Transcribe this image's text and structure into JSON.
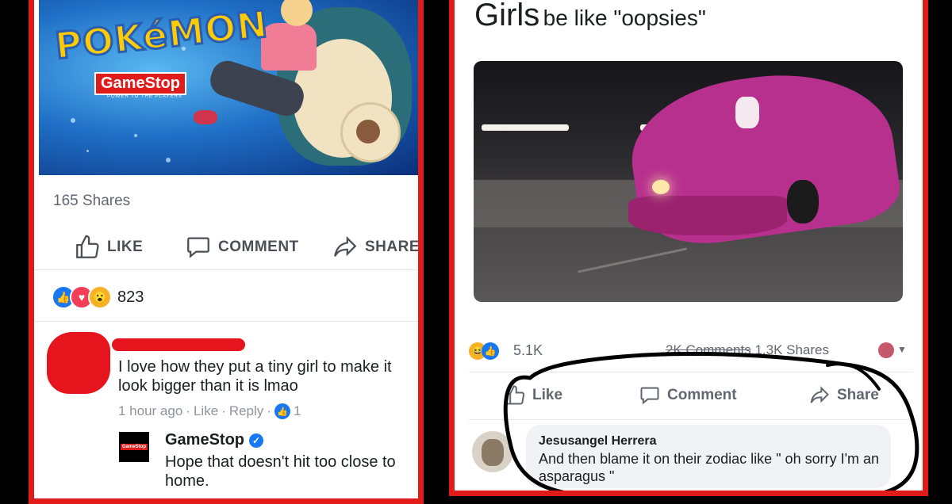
{
  "left_post": {
    "promo_image": {
      "brand_logo": "POKéMON",
      "store_logo": "GameStop",
      "store_tagline": "POWER TO THE PLAYERS"
    },
    "shares": "165 Shares",
    "actions": {
      "like": "LIKE",
      "comment": "COMMENT",
      "share": "SHARE"
    },
    "reactions": {
      "count": "823",
      "types": [
        "like",
        "love",
        "wow"
      ]
    },
    "comment": {
      "text": "I love how they put a tiny girl to make it look bigger than it is lmao",
      "meta": {
        "time": "1 hour ago",
        "like": "Like",
        "reply": "Reply",
        "like_count": "1"
      }
    },
    "reply": {
      "author": "GameStop",
      "avatar_text": "GameStop",
      "text": "Hope that doesn't hit too close to home."
    }
  },
  "right_post": {
    "caption": {
      "bold": "Girls",
      "rest": "be like \"oopsies\""
    },
    "stats": {
      "reaction_count": "5.1K",
      "comments": "2K Comments",
      "shares": "1.3K Shares",
      "reaction_types": [
        "haha",
        "like"
      ]
    },
    "actions": {
      "like": "Like",
      "comment": "Comment",
      "share": "Share"
    },
    "comment": {
      "author": "Jesusangel Herrera",
      "text": "And then blame it on their zodiac like \" oh sorry I'm an asparagus \""
    }
  },
  "colors": {
    "frame_red": "#e11a1a",
    "redaction_red": "#e6141c",
    "facebook_blue": "#1877f2",
    "love_red": "#f33e58",
    "wow_yellow": "#f7b125",
    "text_gray": "#606770"
  }
}
